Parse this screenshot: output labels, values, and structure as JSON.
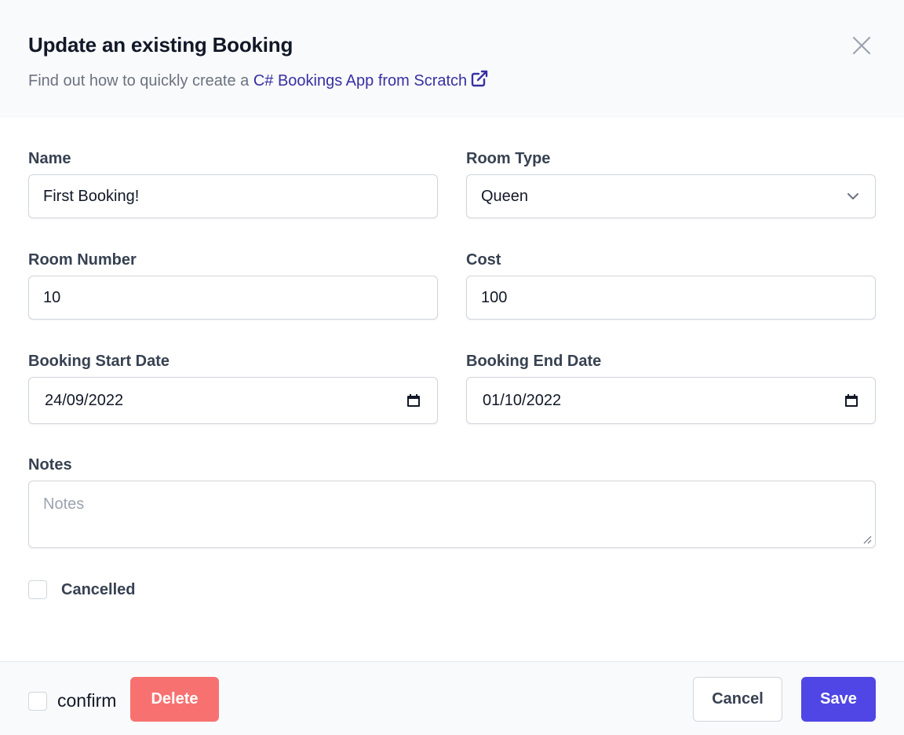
{
  "header": {
    "title": "Update an existing Booking",
    "subtitle_prefix": "Find out how to quickly create a ",
    "subtitle_link": "C# Bookings App from Scratch"
  },
  "form": {
    "name": {
      "label": "Name",
      "value": "First Booking!"
    },
    "room_type": {
      "label": "Room Type",
      "value": "Queen"
    },
    "room_number": {
      "label": "Room Number",
      "value": "10"
    },
    "cost": {
      "label": "Cost",
      "value": "100"
    },
    "start_date": {
      "label": "Booking Start Date",
      "value": "24/09/2022"
    },
    "end_date": {
      "label": "Booking End Date",
      "value": "01/10/2022"
    },
    "notes": {
      "label": "Notes",
      "placeholder": "Notes"
    },
    "cancelled": {
      "label": "Cancelled",
      "checked": false
    }
  },
  "footer": {
    "confirm_label": "confirm",
    "delete_label": "Delete",
    "cancel_label": "Cancel",
    "save_label": "Save"
  },
  "colors": {
    "accent": "#4f46e5",
    "danger": "#f87171",
    "link": "#3730a3"
  }
}
